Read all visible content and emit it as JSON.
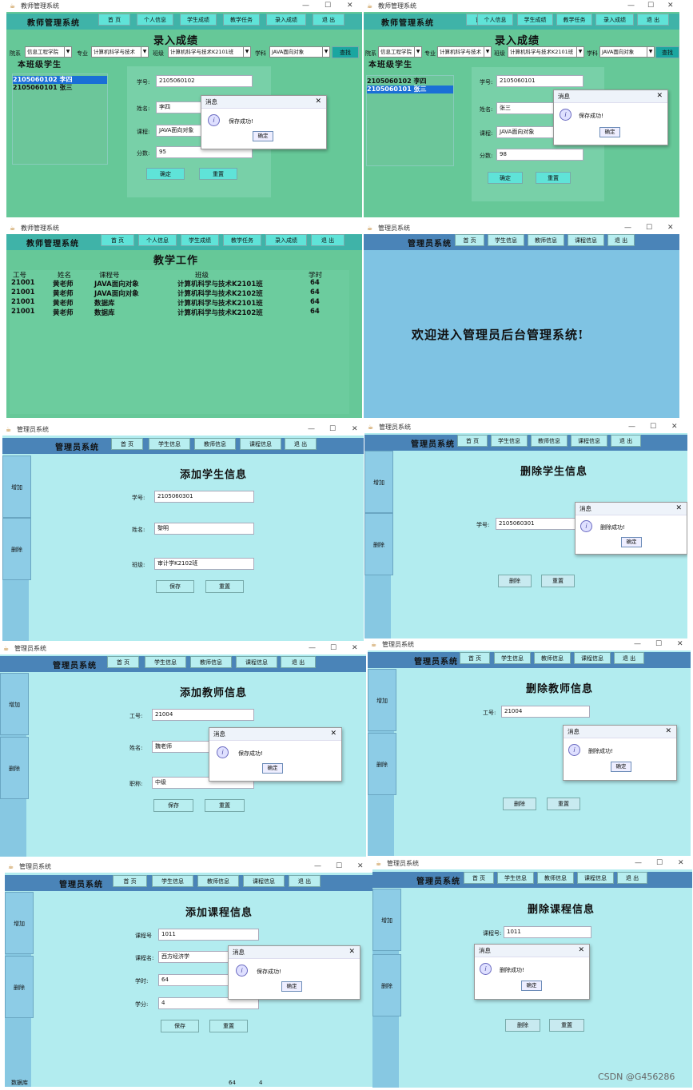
{
  "teacher_title": "教师管理系统",
  "admin_title": "管理员系统",
  "sys_teacher": "教师管理系统",
  "sys_admin": "管理员系统",
  "teacher_nav": [
    "首  页",
    "个人信息",
    "学生成绩",
    "教学任务",
    "录入成绩",
    "退  出"
  ],
  "admin_nav": [
    "首  页",
    "学生信息",
    "教师信息",
    "课程信息",
    "退  出"
  ],
  "ctl": {
    "min": "—",
    "max": "☐",
    "close": "✕"
  },
  "dlg": {
    "title": "消息",
    "save_ok": "保存成功!",
    "del_ok": "删除成功!",
    "ok": "确定"
  },
  "grade_entry": {
    "title": "录入成绩",
    "filters": {
      "college_label": "院系",
      "college": "信息工程学院",
      "major_label": "专业",
      "major": "计算机科学与技术",
      "class_label": "班级",
      "class": "计算机科学与技术K2101班",
      "subject_label": "学科",
      "subject": "JAVA面向对象",
      "search": "查找"
    },
    "list_title": "本班级学生",
    "students": [
      "2105060102 李四",
      "2105060101 张三"
    ],
    "form_a": {
      "id_label": "学号:",
      "id": "2105060102",
      "name_label": "姓名:",
      "name": "李四",
      "course_label": "课程:",
      "course": "JAVA面向对象",
      "score_label": "分数:",
      "score": "95"
    },
    "form_b": {
      "id": "2105060101",
      "name": "张三",
      "course": "JAVA面向对象",
      "score": "98"
    },
    "confirm": "确定",
    "reset": "重置"
  },
  "teaching": {
    "title": "教学工作",
    "headers": [
      "工号",
      "姓名",
      "课程号",
      "班级",
      "学时"
    ],
    "rows": [
      [
        "21001",
        "黄老师",
        "JAVA面向对象",
        "计算机科学与技术K2101班",
        "64"
      ],
      [
        "21001",
        "黄老师",
        "JAVA面向对象",
        "计算机科学与技术K2102班",
        "64"
      ],
      [
        "21001",
        "黄老师",
        "数据库",
        "计算机科学与技术K2101班",
        "64"
      ],
      [
        "21001",
        "黄老师",
        "数据库",
        "计算机科学与技术K2102班",
        "64"
      ]
    ]
  },
  "welcome": "欢迎进入管理员后台管理系统!",
  "side": {
    "add": "增加",
    "del": "删除"
  },
  "add_student": {
    "title": "添加学生信息",
    "id_label": "学号:",
    "id": "2105060301",
    "name_label": "姓名:",
    "name": "黎明",
    "class_label": "班级:",
    "class": "审计学K2102班",
    "save": "保存",
    "reset": "重置"
  },
  "del_student": {
    "title": "删除学生信息",
    "id_label": "学号:",
    "id": "2105060301",
    "del": "删除",
    "reset": "重置"
  },
  "add_teacher": {
    "title": "添加教师信息",
    "id_label": "工号:",
    "id": "21004",
    "name_label": "姓名:",
    "name": "魏老师",
    "title_label": "职称:",
    "job": "中级",
    "save": "保存",
    "reset": "重置"
  },
  "del_teacher": {
    "title": "删除教师信息",
    "id_label": "工号:",
    "id": "21004",
    "del": "删除",
    "reset": "重置"
  },
  "add_course": {
    "title": "添加课程信息",
    "id_label": "课程号",
    "id": "1011",
    "name_label": "课程名:",
    "name": "西方经济学",
    "hours_label": "学时:",
    "hours": "64",
    "credit_label": "学分:",
    "credit": "4",
    "save": "保存",
    "reset": "重置"
  },
  "del_course": {
    "title": "删除课程信息",
    "id_label": "课程号:",
    "id": "1011",
    "del": "删除",
    "reset": "重置"
  },
  "bottom_row": {
    "a": "数据库",
    "b": "64",
    "c": "4"
  },
  "watermark": "CSDN @G456286",
  "colors": {
    "teacher_bg": "#66c898",
    "teacher_nav": "#3fb3a8",
    "admin_bg": "#b2ecef",
    "admin_nav": "#4a84b8",
    "admin_top_bg": "#7fc3e3",
    "select_blue": "#1a6fd6"
  }
}
